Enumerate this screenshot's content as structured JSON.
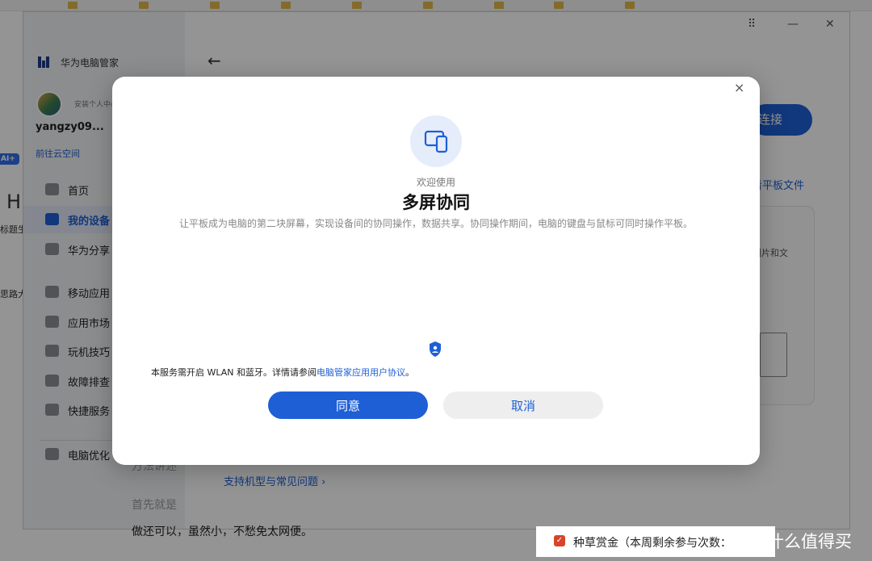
{
  "background_page": {
    "tab_title": "什么值得买",
    "heading_letter": "H",
    "side_text_1": "标题生",
    "side_text_2": "思路大",
    "ai_badge": "AI+",
    "line_1": "首先就是",
    "line_2": "做还可以，虽然小，不愁免太网便。",
    "line_3": "方法讲述",
    "bounty_label": "种草赏金（本周剩余参与次数：",
    "watermark": "什么值得买",
    "watermark_icon": "值"
  },
  "app": {
    "title": "华为电脑管家",
    "user_name": "yangzy09...",
    "avatar_subtitle": "安装个人中心",
    "cloud_link": "前往云空间",
    "nav": [
      {
        "label": "首页",
        "icon": "home-icon"
      },
      {
        "label": "我的设备",
        "icon": "devices-icon",
        "active": true
      },
      {
        "label": "华为分享",
        "icon": "share-icon"
      },
      {
        "label": "移动应用",
        "icon": "mobile-app-icon"
      },
      {
        "label": "应用市场",
        "icon": "app-market-icon"
      },
      {
        "label": "玩机技巧",
        "icon": "tips-icon"
      },
      {
        "label": "故障排查",
        "icon": "wrench-icon"
      },
      {
        "label": "快捷服务",
        "icon": "shield-icon"
      },
      {
        "label": "电脑优化",
        "icon": "optimize-icon"
      }
    ],
    "window_controls": {
      "menu": "⠿",
      "minimize": "—",
      "close": "✕"
    },
    "back": "←",
    "connect_button": "连接",
    "tablet_files_link": "看平板文件",
    "card_text": "图片和文",
    "support_link": "支持机型与常见问题 ›"
  },
  "dialog": {
    "close": "×",
    "welcome": "欢迎使用",
    "title": "多屏协同",
    "description": "让平板成为电脑的第二块屏幕，实现设备间的协同操作，数据共享。协同操作期间，电脑的键盘与鼠标可同时操作平板。",
    "notice_prefix": "本服务需开启 WLAN 和蓝牙。详情请参阅",
    "notice_link": "电脑管家应用用户协议",
    "notice_suffix": "。",
    "agree_button": "同意",
    "cancel_button": "取消"
  },
  "colors": {
    "accent": "#1e5fd6",
    "overlay": "rgba(0,0,0,0.42)",
    "dialog_bg": "#ffffff"
  }
}
